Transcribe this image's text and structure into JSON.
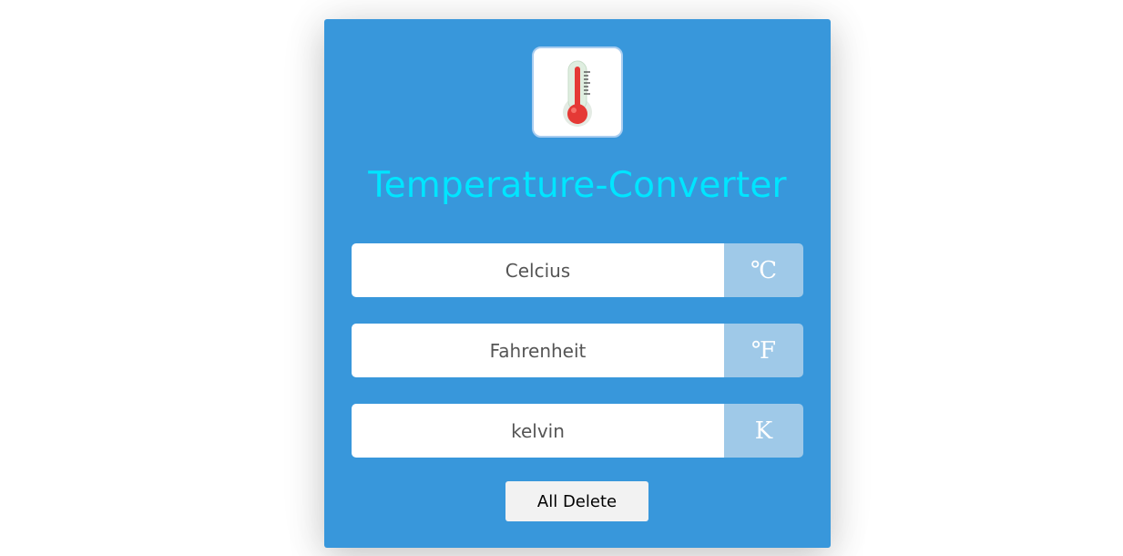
{
  "app": {
    "title": "Temperature-Converter",
    "logo_icon": "thermometer-icon"
  },
  "fields": [
    {
      "placeholder": "Celcius",
      "value": "",
      "unit": "℃"
    },
    {
      "placeholder": "Fahrenheit",
      "value": "",
      "unit": "℉"
    },
    {
      "placeholder": "kelvin",
      "value": "",
      "unit": "K"
    }
  ],
  "actions": {
    "delete_label": "All Delete"
  },
  "colors": {
    "card_background": "#3897db",
    "title_color": "#00e5ff",
    "unit_background": "#9fc9e8",
    "button_background": "#f2f2f2"
  }
}
